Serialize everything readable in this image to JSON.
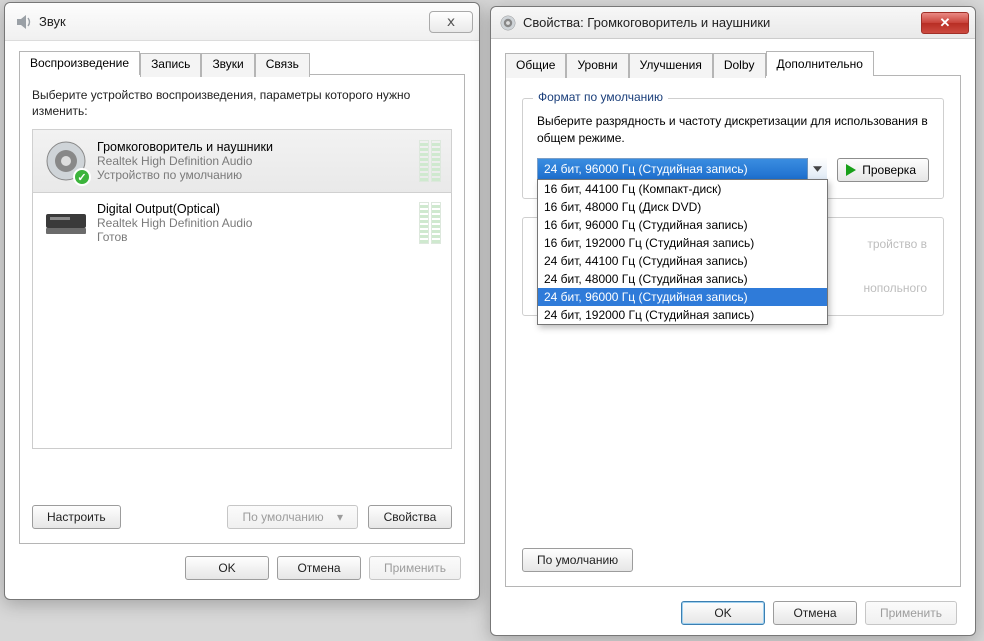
{
  "win1": {
    "title": "Звук",
    "tabs": [
      "Воспроизведение",
      "Запись",
      "Звуки",
      "Связь"
    ],
    "active_tab": 0,
    "instruction": "Выберите устройство воспроизведения, параметры которого нужно изменить:",
    "devices": [
      {
        "name": "Громкоговоритель и наушники",
        "driver": "Realtek High Definition Audio",
        "status": "Устройство по умолчанию",
        "is_default": true,
        "selected": true
      },
      {
        "name": "Digital Output(Optical)",
        "driver": "Realtek High Definition Audio",
        "status": "Готов",
        "is_default": false,
        "selected": false
      }
    ],
    "btn_configure": "Настроить",
    "btn_setdefault": "По умолчанию",
    "btn_properties": "Свойства",
    "btn_ok": "OK",
    "btn_cancel": "Отмена",
    "btn_apply": "Применить"
  },
  "win2": {
    "title": "Свойства: Громкоговоритель и наушники",
    "tabs": [
      "Общие",
      "Уровни",
      "Улучшения",
      "Dolby",
      "Дополнительно"
    ],
    "active_tab": 4,
    "group_default_format": "Формат по умолчанию",
    "format_desc": "Выберите разрядность и частоту дискретизации для использования в общем режиме.",
    "format_selected": "24 бит, 96000 Гц (Студийная запись)",
    "format_options": [
      "16 бит, 44100 Гц (Компакт-диск)",
      "16 бит, 48000 Гц (Диск DVD)",
      "16 бит, 96000 Гц (Студийная запись)",
      "16 бит, 192000 Гц (Студийная запись)",
      "24 бит, 44100 Гц (Студийная запись)",
      "24 бит, 48000 Гц (Студийная запись)",
      "24 бит, 96000 Гц (Студийная запись)",
      "24 бит, 192000 Гц (Студийная запись)"
    ],
    "highlight_index": 6,
    "btn_test": "Проверка",
    "excl_frag1": "тройство в",
    "excl_frag2": "нопольного",
    "btn_default": "По умолчанию",
    "btn_ok": "OK",
    "btn_cancel": "Отмена",
    "btn_apply": "Применить"
  }
}
